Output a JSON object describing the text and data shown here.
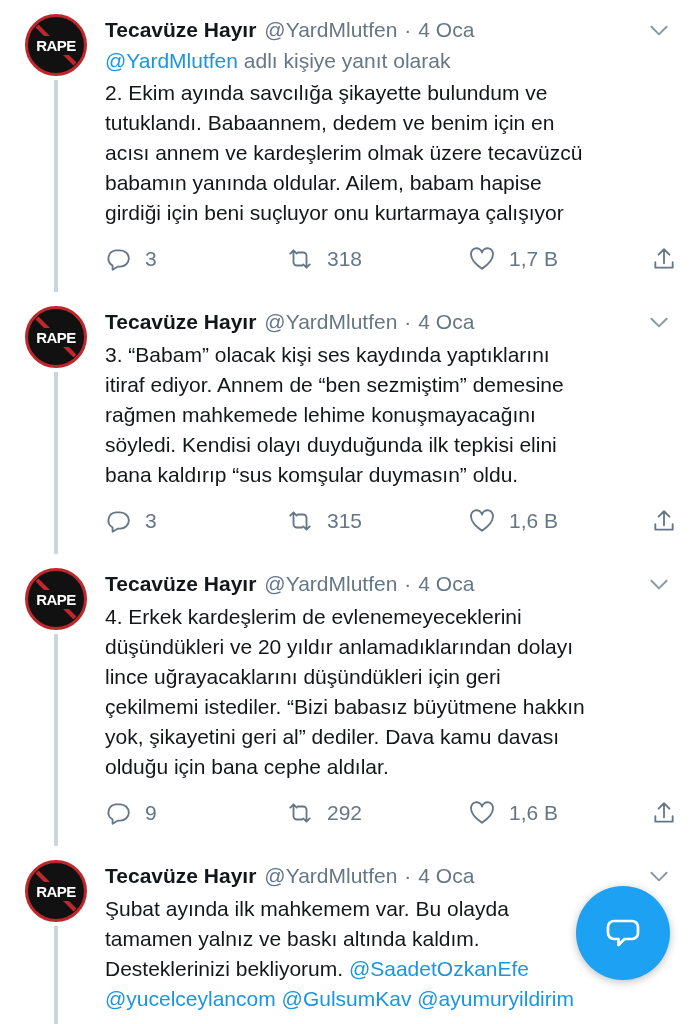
{
  "tweets": [
    {
      "avatar_text": "RAPE",
      "name": "Tecavüze Hayır",
      "handle": "@YardMlutfen",
      "separator": "·",
      "date": "4 Oca",
      "reply_to": {
        "handle": "@YardMlutfen",
        "text": "adlı kişiye yanıt olarak"
      },
      "body": [
        {
          "kind": "text",
          "text": "2. Ekim ayında savcılığa şikayette bulundum ve\ntutuklandı. Babaannem, dedem ve benim için en\nacısı annem ve kardeşlerim olmak üzere tecavüzcü\nbabamın yanında oldular. Ailem, babam hapise\ngirdiği için beni suçluyor onu kurtarmaya çalışıyor"
        }
      ],
      "replies": "3",
      "retweets": "318",
      "likes": "1,7 B"
    },
    {
      "avatar_text": "RAPE",
      "name": "Tecavüze Hayır",
      "handle": "@YardMlutfen",
      "separator": "·",
      "date": "4 Oca",
      "body": [
        {
          "kind": "text",
          "text": "3. “Babam” olacak kişi ses kaydında yaptıklarını\nitiraf ediyor. Annem de “ben sezmiştim” demesine\nrağmen mahkemede lehime konuşmayacağını\nsöyledi. Kendisi olayı duyduğunda ilk tepkisi elini\nbana kaldırıp “sus komşular duymasın” oldu."
        }
      ],
      "replies": "3",
      "retweets": "315",
      "likes": "1,6 B"
    },
    {
      "avatar_text": "RAPE",
      "name": "Tecavüze Hayır",
      "handle": "@YardMlutfen",
      "separator": "·",
      "date": "4 Oca",
      "body": [
        {
          "kind": "text",
          "text": "4. Erkek kardeşlerim de evlenemeyeceklerini\ndüşündükleri ve 20 yıldır anlamadıklarından dolayı\nlince uğrayacaklarını düşündükleri için geri\nçekilmemi istediler. “Bizi babasız büyütmene hakkın\nyok, şikayetini geri al” dediler. Dava kamu davası\nolduğu için bana cephe aldılar."
        }
      ],
      "replies": "9",
      "retweets": "292",
      "likes": "1,6 B"
    },
    {
      "avatar_text": "RAPE",
      "name": "Tecavüze Hayır",
      "handle": "@YardMlutfen",
      "separator": "·",
      "date": "4 Oca",
      "body": [
        {
          "kind": "text",
          "text": "Şubat ayında ilk mahkemem var. Bu olayda\ntamamen yalnız ve baskı altında kaldım.\nDesteklerinizi bekliyorum. "
        },
        {
          "kind": "mention",
          "text": "@SaadetOzkanEfe"
        },
        {
          "kind": "break"
        },
        {
          "kind": "mention",
          "text": "@yucelceylancom"
        },
        {
          "kind": "space"
        },
        {
          "kind": "mention",
          "text": "@GulsumKav"
        },
        {
          "kind": "space"
        },
        {
          "kind": "mention",
          "text": "@ayumuryildirim"
        }
      ]
    }
  ]
}
